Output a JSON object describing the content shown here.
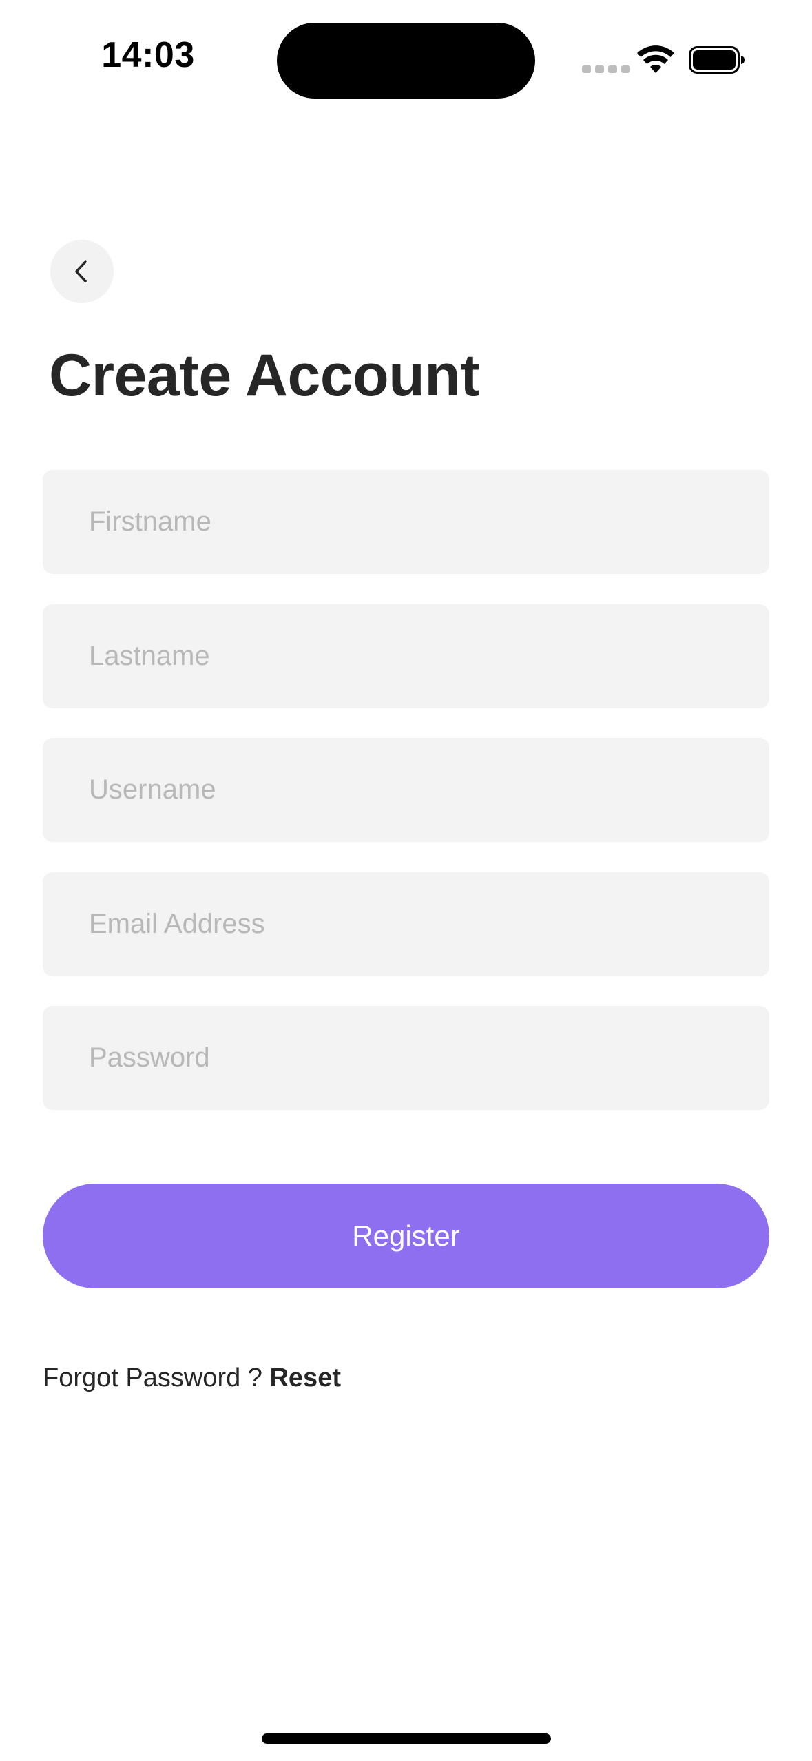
{
  "status_bar": {
    "time": "14:03",
    "icons": [
      "cellular-signal-icon",
      "wifi-icon",
      "battery-icon"
    ]
  },
  "header": {
    "back_icon": "chevron-left-icon",
    "title": "Create Account"
  },
  "form": {
    "firstname_placeholder": "Firstname",
    "lastname_placeholder": "Lastname",
    "username_placeholder": "Username",
    "email_placeholder": "Email Address",
    "password_placeholder": "Password",
    "register_label": "Register"
  },
  "footer": {
    "forgot_text": "Forgot Password ? ",
    "reset_label": "Reset"
  },
  "colors": {
    "accent": "#8d6fef",
    "field_background": "#f3f3f3",
    "placeholder": "#b8b8b8",
    "title_text": "#262626"
  }
}
